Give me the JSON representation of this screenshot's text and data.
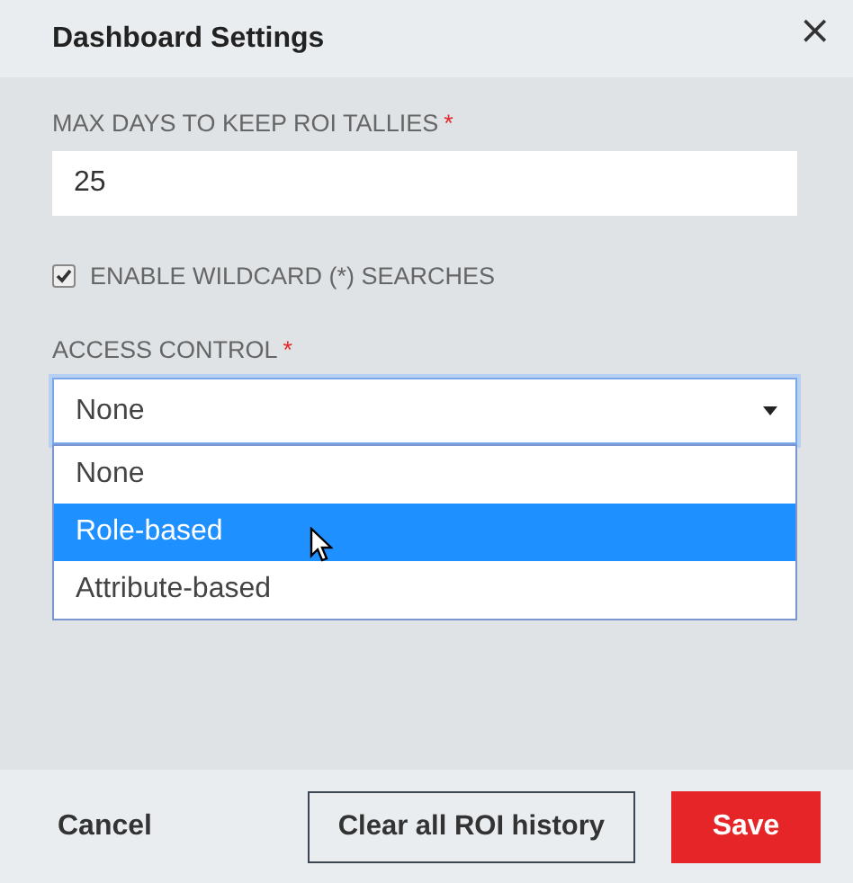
{
  "dialog": {
    "title": "Dashboard Settings",
    "close": "×"
  },
  "fields": [
    {
      "kind": "text",
      "label": "MAX DAYS TO KEEP ROI TALLIES",
      "required_mark": "*",
      "value": "25"
    },
    {
      "kind": "checkbox",
      "label": "ENABLE WILDCARD (*) SEARCHES",
      "checked": true
    },
    {
      "kind": "select",
      "label": "ACCESS CONTROL",
      "required_mark": "*",
      "value": "None",
      "expanded": true,
      "options": [
        {
          "label": "None",
          "highlighted": false
        },
        {
          "label": "Role-based",
          "highlighted": true
        },
        {
          "label": "Attribute-based",
          "highlighted": false
        }
      ]
    }
  ],
  "footer": {
    "cancel": "Cancel",
    "clear": "Clear all ROI history",
    "save": "Save"
  }
}
